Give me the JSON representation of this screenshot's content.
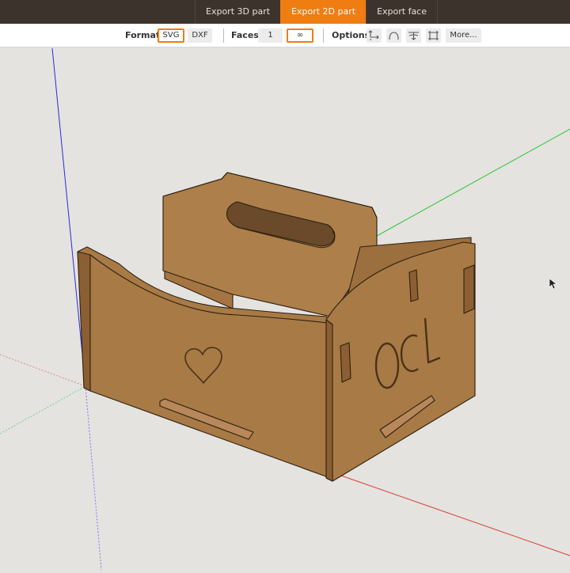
{
  "tabs": [
    {
      "label": "Export 3D part",
      "active": false
    },
    {
      "label": "Export 2D part",
      "active": true
    },
    {
      "label": "Export face",
      "active": false
    }
  ],
  "toolbar": {
    "format_label": "Format",
    "format_options": [
      "SVG",
      "DXF"
    ],
    "format_selected": "SVG",
    "faces_label": "Faces",
    "faces_options": [
      "1",
      "∞"
    ],
    "faces_selected": "∞",
    "options_label": "Options",
    "option_icons": [
      "dimension-icon",
      "arc-icon",
      "depth-icon",
      "bounding-box-icon"
    ],
    "more_label": "More..."
  },
  "model": {
    "engraving_text": "OCL",
    "engraving_shape": "heart-icon"
  },
  "colors": {
    "accent": "#ef7d12",
    "topbar_bg": "#3c342c",
    "wood": "#a87a45"
  }
}
